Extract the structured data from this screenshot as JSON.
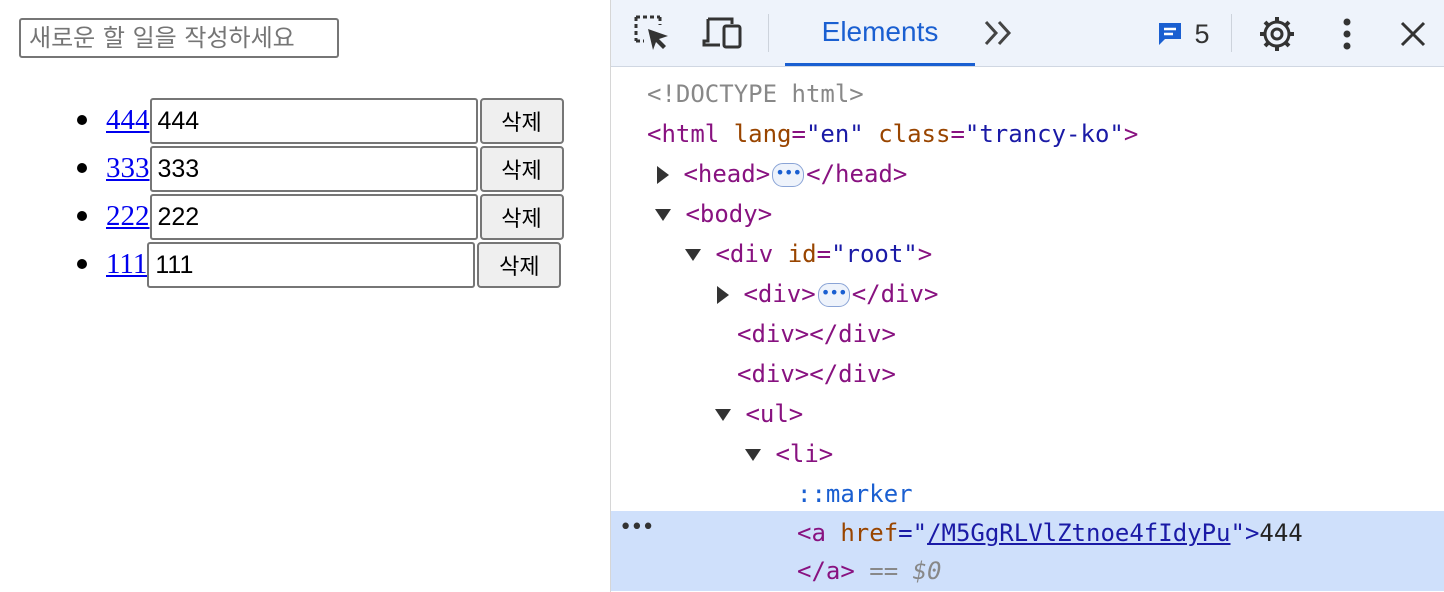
{
  "page": {
    "new_todo_placeholder": "새로운 할 일을 작성하세요",
    "todos": [
      {
        "link": "444",
        "value": "444",
        "delete_label": "삭제"
      },
      {
        "link": "333",
        "value": "333",
        "delete_label": "삭제"
      },
      {
        "link": "222",
        "value": "222",
        "delete_label": "삭제"
      },
      {
        "link": "111",
        "value": "111",
        "delete_label": "삭제"
      }
    ]
  },
  "devtools": {
    "toolbar": {
      "inspect_icon": "inspect-element-icon",
      "device_icon": "device-toolbar-icon",
      "tab_label": "Elements",
      "more_tabs_icon": "double-chevron-right-icon",
      "issues_icon": "message-icon",
      "issues_count": "5",
      "settings_icon": "gear-icon",
      "menu_icon": "kebab-menu-icon",
      "close_icon": "close-icon"
    },
    "dom": {
      "doctype": "<!DOCTYPE html>",
      "html_open": "<html",
      "html_lang_attr": "lang",
      "html_lang_val": "\"en\"",
      "html_class_attr": "class",
      "html_class_val": "\"trancy-ko\"",
      "html_close_bracket": ">",
      "head_open": "<head>",
      "head_close": "</head>",
      "body_open": "<body>",
      "div_open": "<div",
      "div_id_attr": "id",
      "div_id_val": "\"root\"",
      "tag_close_bracket": ">",
      "inner_div_open": "<div>",
      "inner_div_close": "</div>",
      "empty_div_1": "<div></div>",
      "empty_div_2": "<div></div>",
      "ul_open": "<ul>",
      "li_open": "<li>",
      "marker": "::marker",
      "a_open": "<a",
      "a_href_attr": "href",
      "a_href_eq": "=\"",
      "a_href_val": "/M5GgRLVlZtnoe4fIdyPu",
      "a_href_endquote": "\">",
      "a_text": "444",
      "a_close": "</a>",
      "selected_marker": "== $0"
    }
  }
}
